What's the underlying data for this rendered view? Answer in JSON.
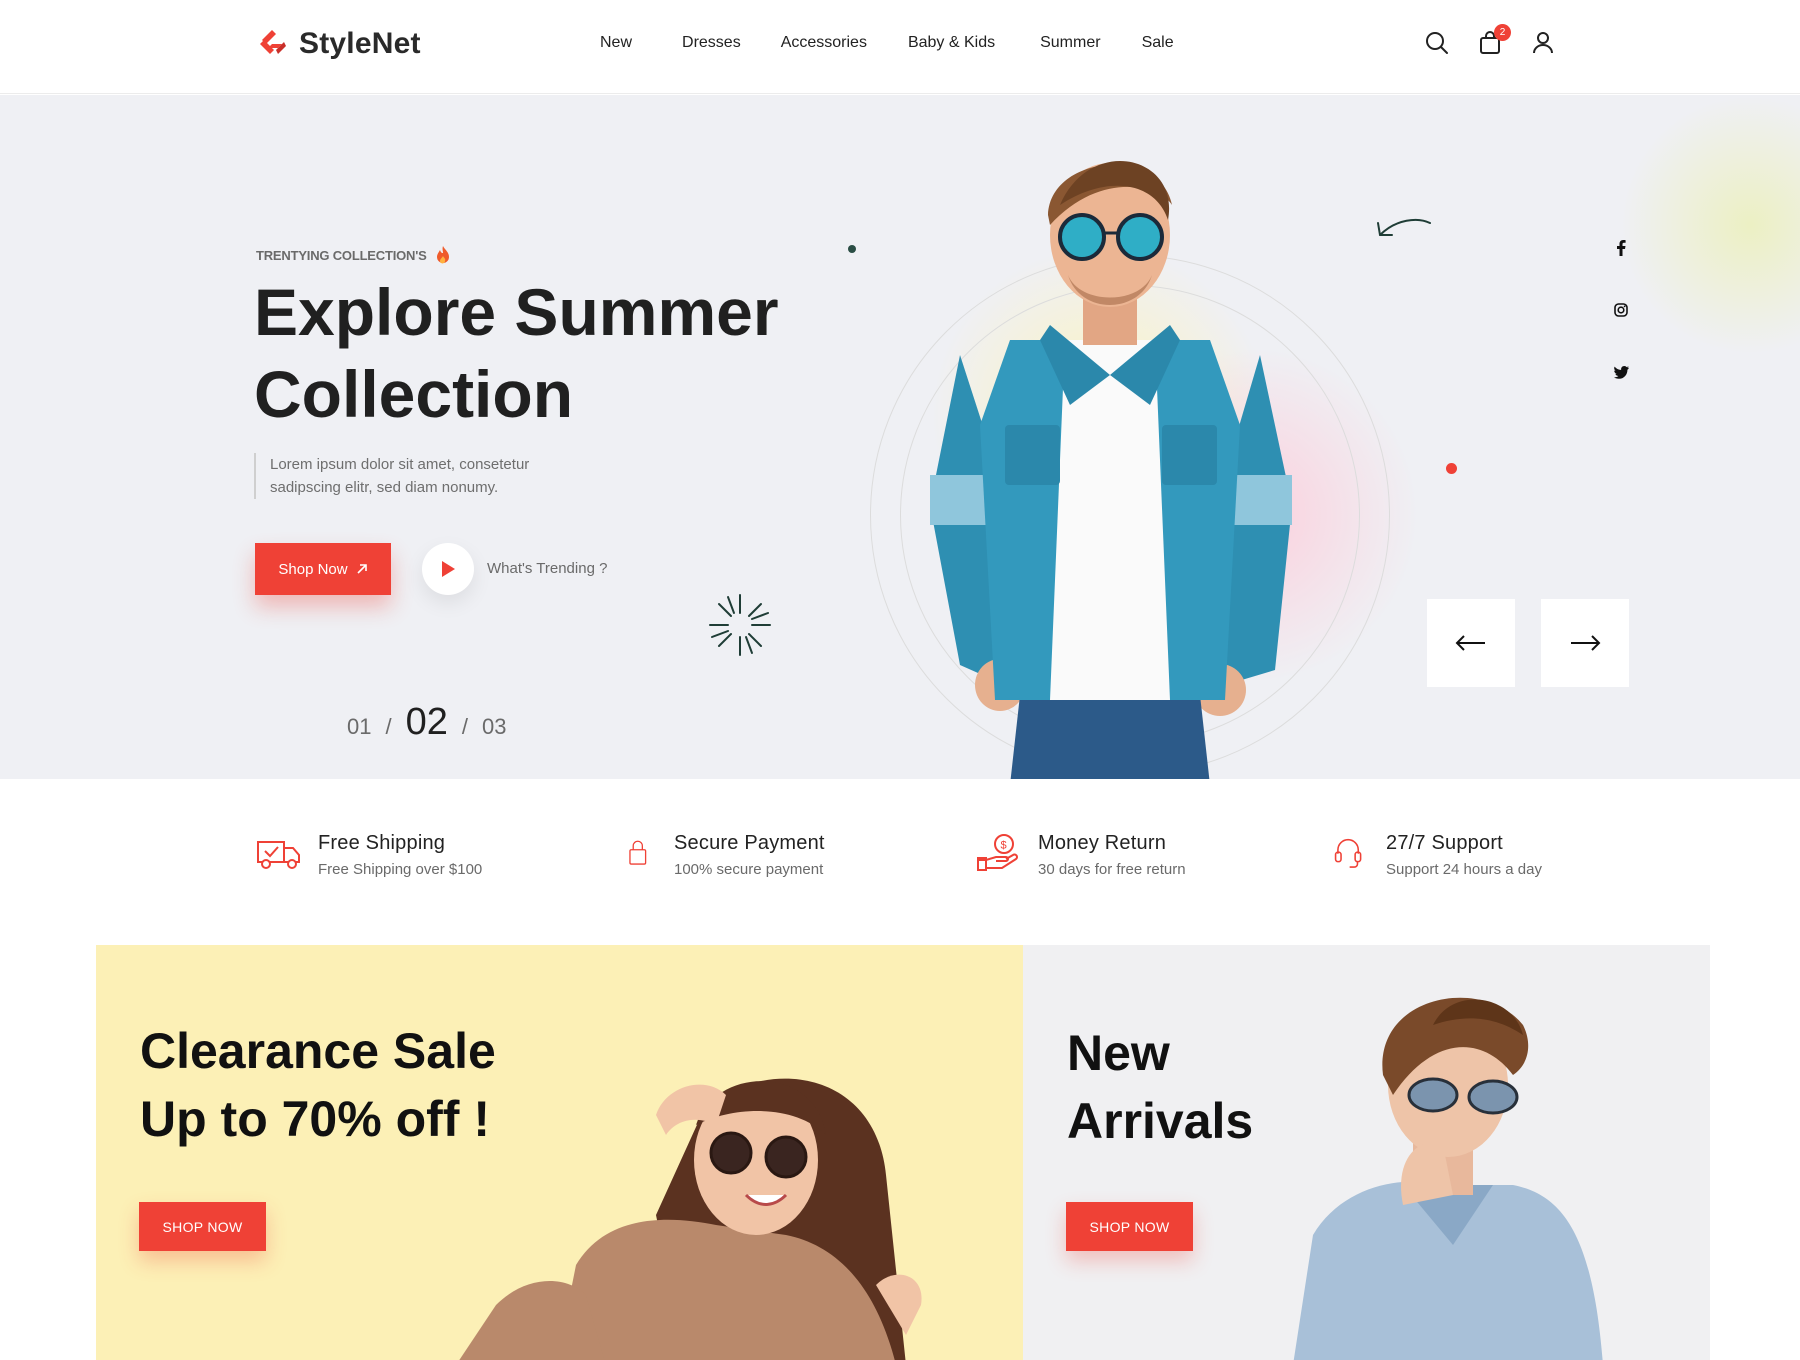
{
  "brand": {
    "name": "StyleNet",
    "accent": "#ef4136"
  },
  "nav": {
    "items": [
      "New",
      "Dresses",
      "Accessories",
      "Baby & Kids",
      "Summer",
      "Sale"
    ]
  },
  "header_icons": {
    "search": "search-icon",
    "cart": "shopping-bag-icon",
    "cart_count": "2",
    "account": "user-icon"
  },
  "hero": {
    "tag": "TRENTYING COLLECTION'S",
    "title_line1": "Explore Summer",
    "title_line2": "Collection",
    "desc_line1": "Lorem ipsum dolor sit amet, consetetur",
    "desc_line2": "sadipscing elitr, sed diam nonumy.",
    "shop_label": "Shop Now",
    "trending_label": "What's Trending ?",
    "pager": {
      "prev": "01",
      "current": "02",
      "next": "03",
      "sep": "/"
    },
    "social": [
      "facebook-icon",
      "instagram-icon",
      "twitter-icon"
    ],
    "arrows": [
      "arrow-left-icon",
      "arrow-right-icon"
    ]
  },
  "features": [
    {
      "title": "Free Shipping",
      "sub": "Free Shipping over $100",
      "icon": "truck-icon"
    },
    {
      "title": "Secure Payment",
      "sub": "100% secure payment",
      "icon": "lock-icon"
    },
    {
      "title": "Money Return",
      "sub": "30 days for free return",
      "icon": "money-hand-icon"
    },
    {
      "title": "27/7 Support",
      "sub": "Support 24 hours a day",
      "icon": "headset-icon"
    }
  ],
  "banners": {
    "clearance": {
      "line1": "Clearance Sale",
      "line2": "Up to 70% off !",
      "btn": "SHOP NOW",
      "bg": "#fcf0b6"
    },
    "arrivals": {
      "line1": "New",
      "line2": "Arrivals",
      "btn": "SHOP NOW",
      "bg": "#f0f0f2"
    }
  }
}
